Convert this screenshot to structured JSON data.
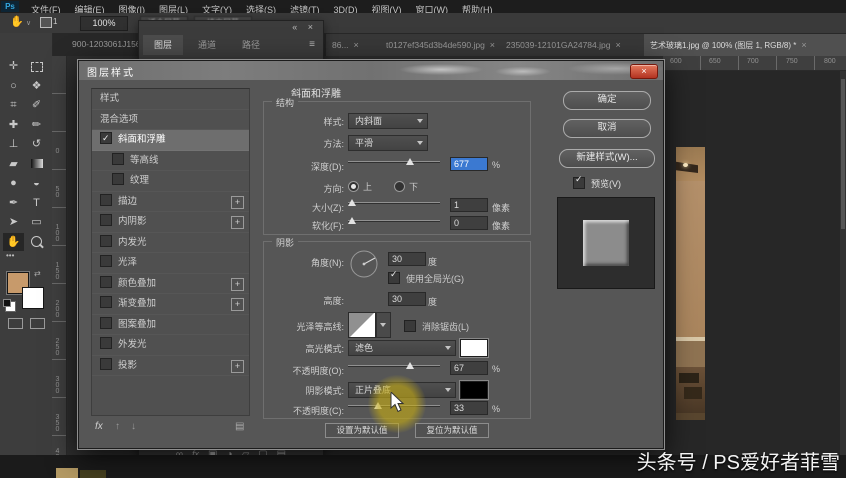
{
  "colors": {
    "accent_blue": "#3b79d1",
    "close_red": "#c13a26",
    "foreground_swatch": "#c79a6b",
    "background_swatch": "#ffffff"
  },
  "menu_bar": {
    "logo": "Ps",
    "items": [
      "文件(F)",
      "编辑(E)",
      "图像(I)",
      "图层(L)",
      "文字(Y)",
      "选择(S)",
      "滤镜(T)",
      "3D(D)",
      "视图(V)",
      "窗口(W)",
      "帮助(H)"
    ]
  },
  "options_bar": {
    "hand_glyph": "✋",
    "zoom_value": "100%",
    "arrange_count": "1",
    "buttons": [
      "适合屏幕",
      "填充屏幕"
    ]
  },
  "panel_group": {
    "collapse_icon": "«",
    "close_icon": "×",
    "tabs": [
      "图层",
      "通道",
      "路径"
    ],
    "menu_icon": "≡",
    "footer_icons": [
      {
        "name": "link",
        "glyph": "∞"
      },
      {
        "name": "layer-effects",
        "glyph": "fx"
      },
      {
        "name": "layer-mask",
        "glyph": "▣"
      },
      {
        "name": "adjustment",
        "glyph": "◑"
      },
      {
        "name": "group-folder",
        "glyph": "▱"
      },
      {
        "name": "new-layer",
        "glyph": "▢"
      },
      {
        "name": "delete-layer",
        "glyph": "▤"
      }
    ]
  },
  "document_tabs": {
    "overflow_icon": "«",
    "partial_tab": "900-1203061J15611.",
    "tabs": [
      {
        "label": "86...",
        "close": "×"
      },
      {
        "label": "t0127ef345d3b4de590.jpg",
        "close": "×"
      },
      {
        "label": "235039-12101GA24784.jpg",
        "close": "×"
      },
      {
        "label": "艺术玻璃1.jpg @ 100% (图层 1, RGB/8) *",
        "close": "×"
      }
    ]
  },
  "toolbar": {
    "tools": [
      {
        "name": "move",
        "glyph": "✛"
      },
      {
        "name": "marquee",
        "glyph": ""
      },
      {
        "name": "lasso",
        "glyph": "○"
      },
      {
        "name": "quick-select",
        "glyph": "❖"
      },
      {
        "name": "crop",
        "glyph": "⌗"
      },
      {
        "name": "eyedropper",
        "glyph": "✐"
      },
      {
        "name": "healing-brush",
        "glyph": "✚"
      },
      {
        "name": "brush",
        "glyph": "✏"
      },
      {
        "name": "clone-stamp",
        "glyph": "⊥"
      },
      {
        "name": "history-brush",
        "glyph": "↺"
      },
      {
        "name": "eraser",
        "glyph": "▰"
      },
      {
        "name": "gradient",
        "glyph": ""
      },
      {
        "name": "blur",
        "glyph": "●"
      },
      {
        "name": "dodge",
        "glyph": "◒"
      },
      {
        "name": "pen",
        "glyph": "✒"
      },
      {
        "name": "type",
        "glyph": "T"
      },
      {
        "name": "path-select",
        "glyph": "➤"
      },
      {
        "name": "shape",
        "glyph": "▭"
      },
      {
        "name": "hand",
        "glyph": "✋"
      },
      {
        "name": "zoom",
        "glyph": ""
      }
    ],
    "more_dots": "•••",
    "swap_icon": "⇄"
  },
  "rulers": {
    "horizontal": [
      "600",
      "650",
      "700",
      "750",
      "800"
    ],
    "vertical": [
      "0",
      "50",
      "100",
      "150",
      "200",
      "250",
      "300",
      "350",
      "400"
    ]
  },
  "dialog": {
    "title": "图层样式",
    "close": "×",
    "styles_list": {
      "rows": [
        {
          "label": "样式"
        },
        {
          "label": "混合选项"
        },
        {
          "label": "斜面和浮雕"
        },
        {
          "label": "等高线"
        },
        {
          "label": "纹理"
        },
        {
          "label": "描边",
          "plus": "+"
        },
        {
          "label": "内阴影",
          "plus": "+"
        },
        {
          "label": "内发光"
        },
        {
          "label": "光泽"
        },
        {
          "label": "颜色叠加",
          "plus": "+"
        },
        {
          "label": "渐变叠加",
          "plus": "+"
        },
        {
          "label": "图案叠加"
        },
        {
          "label": "外发光"
        },
        {
          "label": "投影",
          "plus": "+"
        }
      ],
      "footer": {
        "fx": "fx",
        "up": "↑",
        "down": "↓",
        "trash": "▤"
      }
    },
    "bevel": {
      "header": "斜面和浮雕",
      "structure": {
        "title": "结构",
        "style_label": "样式:",
        "style_value": "内斜面",
        "method_label": "方法:",
        "method_value": "平滑",
        "depth_label": "深度(D):",
        "depth_value": "677",
        "depth_unit": "%",
        "direction_label": "方向:",
        "up": "上",
        "down": "下",
        "size_label": "大小(Z):",
        "size_value": "1",
        "size_unit": "像素",
        "soften_label": "软化(F):",
        "soften_value": "0",
        "soften_unit": "像素"
      },
      "shading": {
        "title": "阴影",
        "angle_label": "角度(N):",
        "angle_value": "30",
        "angle_unit": "度",
        "use_global": "使用全局光(G)",
        "altitude_label": "高度:",
        "altitude_value": "30",
        "altitude_unit": "度",
        "gloss_label": "光泽等高线:",
        "anti_alias": "消除锯齿(L)",
        "highlight_label": "高光模式:",
        "highlight_value": "滤色",
        "opacity_hl_label": "不透明度(O):",
        "opacity_hl_value": "67",
        "opacity_hl_unit": "%",
        "shadow_label": "阴影模式:",
        "shadow_value": "正片叠底",
        "opacity_sh_label": "不透明度(C):",
        "opacity_sh_value": "33",
        "opacity_sh_unit": "%"
      },
      "footer_buttons": [
        "设置为默认值",
        "复位为默认值"
      ]
    },
    "actions": {
      "ok": "确定",
      "cancel": "取消",
      "new_style": "新建样式(W)...",
      "preview": "预览(V)"
    }
  },
  "watermark": "头条号 / PS爱好者菲雪"
}
